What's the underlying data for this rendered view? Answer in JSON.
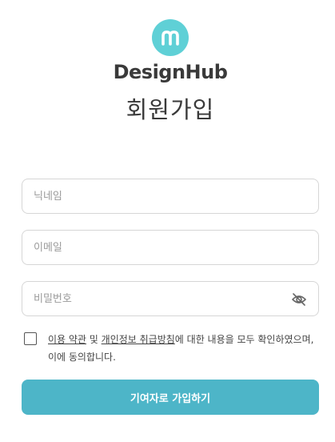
{
  "brand": {
    "logo_icon": "m-logo-icon",
    "logo_letter": "m",
    "name": "DesignHub",
    "accent_color": "#5fd0d6"
  },
  "page": {
    "title": "회원가입"
  },
  "form": {
    "nickname": {
      "placeholder": "닉네임",
      "value": ""
    },
    "email": {
      "placeholder": "이메일",
      "value": ""
    },
    "password": {
      "placeholder": "비밀번호",
      "value": "",
      "toggle_icon": "eye-off-icon"
    }
  },
  "agreement": {
    "checked": false,
    "terms_link": "이용 약관",
    "connector": " 및 ",
    "privacy_link": "개인정보 취급방침",
    "text_after": "에 대한 내용을 모두 확인하였으며, 이에 동의합니다."
  },
  "submit": {
    "label": "기여자로 가입하기",
    "color": "#4db5c8"
  }
}
